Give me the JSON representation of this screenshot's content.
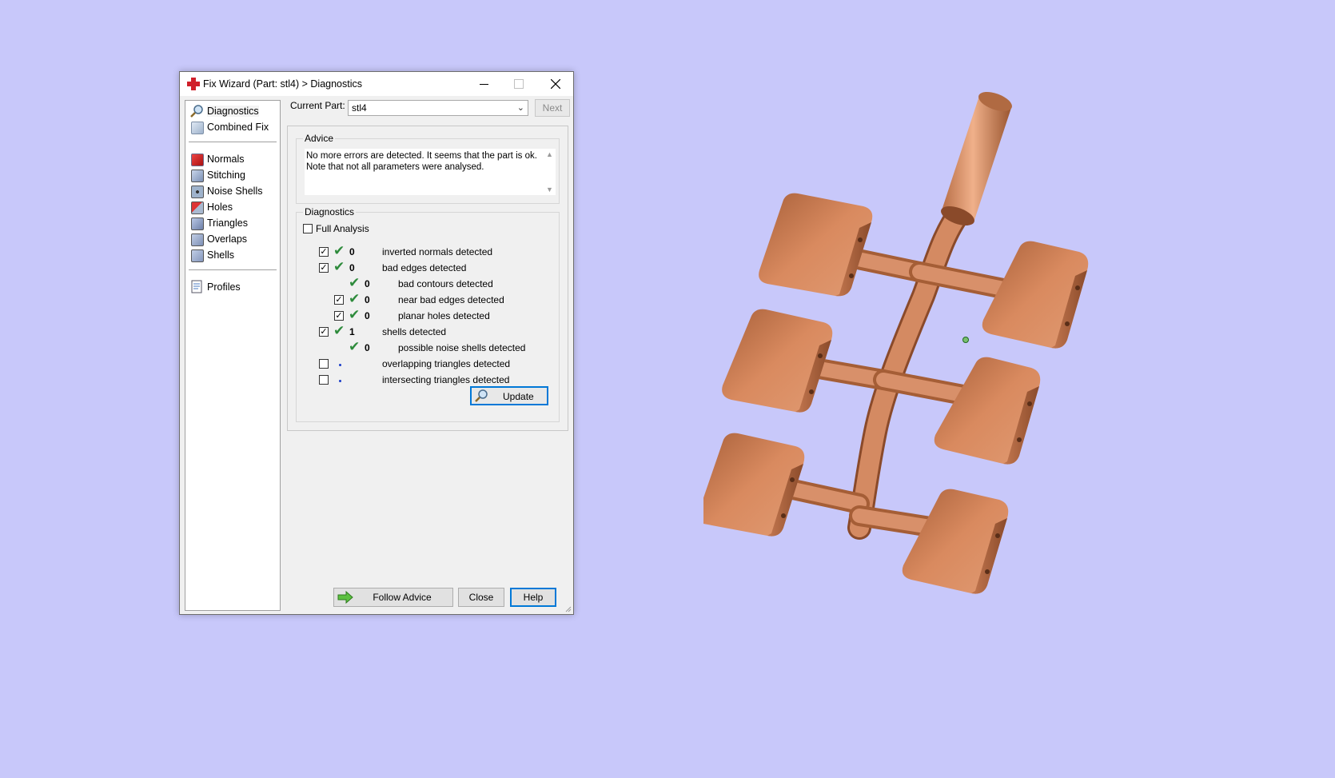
{
  "window": {
    "title": "Fix Wizard (Part: stl4) > Diagnostics"
  },
  "nav": {
    "items": [
      {
        "label": "Diagnostics",
        "icon": "magnifier-icon"
      },
      {
        "label": "Combined Fix",
        "icon": "combined-fix-icon"
      },
      {
        "label": "Normals",
        "icon": "normals-icon"
      },
      {
        "label": "Stitching",
        "icon": "stitching-icon"
      },
      {
        "label": "Noise Shells",
        "icon": "noise-shells-icon"
      },
      {
        "label": "Holes",
        "icon": "holes-icon"
      },
      {
        "label": "Triangles",
        "icon": "triangles-icon"
      },
      {
        "label": "Overlaps",
        "icon": "overlaps-icon"
      },
      {
        "label": "Shells",
        "icon": "shells-icon"
      },
      {
        "label": "Profiles",
        "icon": "profiles-icon"
      }
    ],
    "selected": "Diagnostics"
  },
  "part": {
    "label": "Current Part:",
    "value": "stl4",
    "next_label": "Next"
  },
  "advice": {
    "title": "Advice",
    "text": "No more errors are detected. It seems that the part is ok.\nNote that not all parameters were analysed."
  },
  "diagnostics": {
    "title": "Diagnostics",
    "full_analysis_label": "Full Analysis",
    "full_analysis_checked": false,
    "rows": [
      {
        "checkbox": true,
        "checked": true,
        "status": "ok",
        "count": "0",
        "label": "inverted normals detected",
        "indent": 0
      },
      {
        "checkbox": true,
        "checked": true,
        "status": "ok",
        "count": "0",
        "label": "bad edges detected",
        "indent": 0
      },
      {
        "checkbox": false,
        "checked": false,
        "status": "ok",
        "count": "0",
        "label": "bad contours detected",
        "indent": 1
      },
      {
        "checkbox": true,
        "checked": true,
        "status": "ok",
        "count": "0",
        "label": "near bad edges detected",
        "indent": 1
      },
      {
        "checkbox": true,
        "checked": true,
        "status": "ok",
        "count": "0",
        "label": "planar holes detected",
        "indent": 1
      },
      {
        "checkbox": true,
        "checked": true,
        "status": "ok",
        "count": "1",
        "label": "shells detected",
        "indent": 0
      },
      {
        "checkbox": false,
        "checked": false,
        "status": "ok",
        "count": "0",
        "label": "possible noise shells detected",
        "indent": 1
      },
      {
        "checkbox": true,
        "checked": false,
        "status": "pending",
        "count": "",
        "label": "overlapping triangles detected",
        "indent": 0
      },
      {
        "checkbox": true,
        "checked": false,
        "status": "pending",
        "count": "",
        "label": "intersecting triangles detected",
        "indent": 0
      }
    ],
    "update_label": "Update"
  },
  "footer": {
    "follow_label": "Follow Advice",
    "close_label": "Close",
    "help_label": "Help"
  },
  "colors": {
    "background": "#c8c8fa",
    "check_green": "#2e8b3c",
    "model_copper": "#d8875e"
  }
}
